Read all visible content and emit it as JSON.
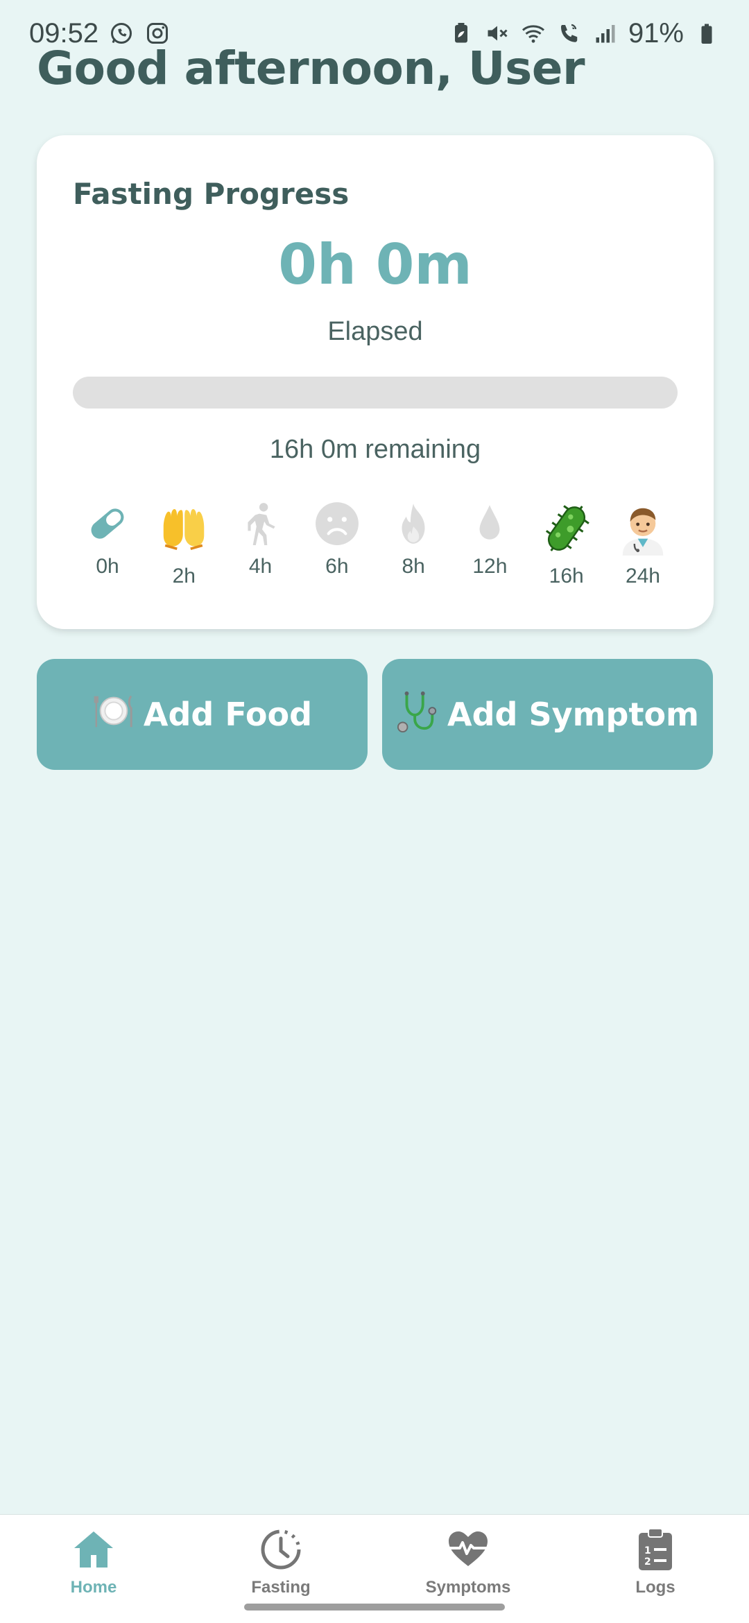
{
  "status_bar": {
    "time": "09:52",
    "battery": "91%",
    "left_icons": [
      "whatsapp-icon",
      "instagram-icon"
    ],
    "right_icons": [
      "battery-saver-icon",
      "mute-icon",
      "wifi-icon",
      "wifi-call-icon",
      "signal-icon",
      "battery-icon"
    ]
  },
  "greeting": "Good afternoon, User",
  "fasting_card": {
    "title": "Fasting Progress",
    "elapsed_value": "0h 0m",
    "elapsed_label": "Elapsed",
    "progress_fraction": 0,
    "remaining": "16h 0m remaining",
    "milestones": [
      {
        "label": "0h",
        "icon": "pill-icon"
      },
      {
        "label": "2h",
        "icon": "raised-hands-icon"
      },
      {
        "label": "4h",
        "icon": "walking-person-icon"
      },
      {
        "label": "6h",
        "icon": "sad-face-icon"
      },
      {
        "label": "8h",
        "icon": "flame-icon"
      },
      {
        "label": "12h",
        "icon": "droplet-icon"
      },
      {
        "label": "16h",
        "icon": "microbe-icon"
      },
      {
        "label": "24h",
        "icon": "doctor-icon"
      }
    ]
  },
  "actions": {
    "add_food": "Add Food",
    "add_symptom": "Add Symptom"
  },
  "bottom_nav": {
    "items": [
      {
        "label": "Home",
        "icon": "home-icon",
        "active": true
      },
      {
        "label": "Fasting",
        "icon": "clock-icon",
        "active": false
      },
      {
        "label": "Symptoms",
        "icon": "heart-pulse-icon",
        "active": false
      },
      {
        "label": "Logs",
        "icon": "clipboard-list-icon",
        "active": false
      }
    ]
  },
  "colors": {
    "background": "#e8f5f4",
    "accent": "#6eb3b5",
    "text": "#3f5e5c",
    "progress_track": "#e0e0e0"
  }
}
